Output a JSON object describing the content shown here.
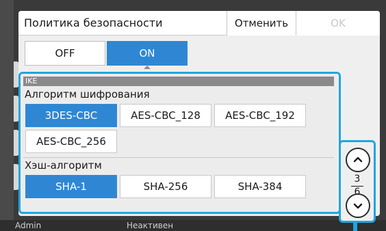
{
  "dialog": {
    "title": "Политика безопасности",
    "cancel_label": "Отменить",
    "ok_label": "OK"
  },
  "toggle": {
    "off_label": "OFF",
    "on_label": "ON",
    "selected": "ON"
  },
  "section": {
    "header": "IKE",
    "encryption_label": "Алгоритм шифрования",
    "encryption_options": [
      "3DES-CBC",
      "AES-CBC_128",
      "AES-CBC_192",
      "AES-CBC_256"
    ],
    "encryption_selected": "3DES-CBC",
    "hash_label": "Хэш-алгоритм",
    "hash_options": [
      "SHA-1",
      "SHA-256",
      "SHA-384"
    ],
    "hash_selected": "SHA-1"
  },
  "pager": {
    "current": "3",
    "total": "6"
  },
  "footer": {
    "user": "Admin",
    "status": "Неактивен"
  },
  "colors": {
    "accent": "#2f87d4",
    "highlight": "#1ea6e0"
  }
}
